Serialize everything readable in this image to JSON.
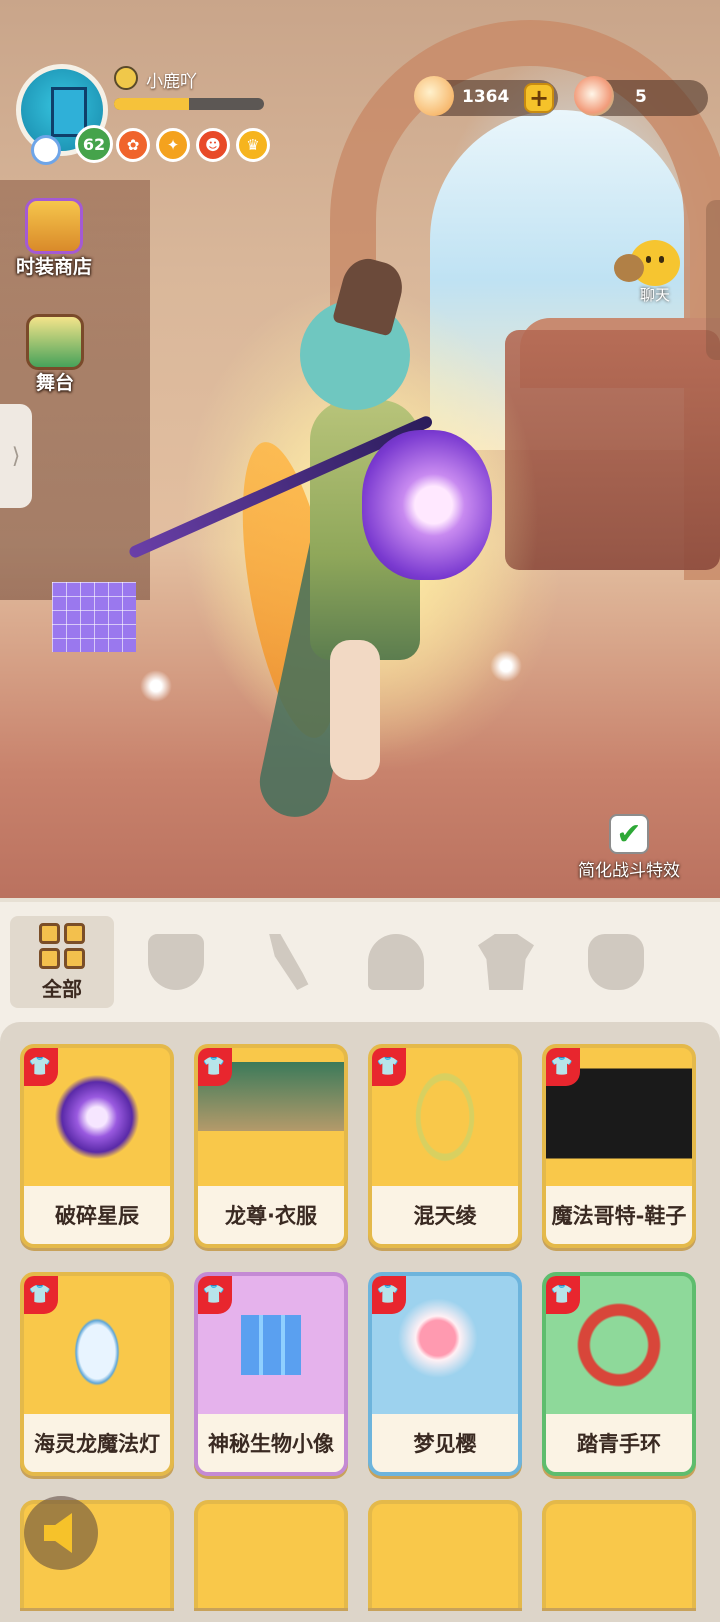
{
  "player": {
    "name": "小鹿吖",
    "level": "62",
    "exp_progress": 0.5
  },
  "currency": {
    "coins": "1364",
    "gems": "5"
  },
  "side_buttons": {
    "fashion_shop": "时装商店",
    "stage": "舞台"
  },
  "chat": {
    "label": "聊天"
  },
  "simplify_effects": {
    "label": "简化战斗特效",
    "checked": true,
    "check_glyph": "✔"
  },
  "drawer_glyph": "⟩",
  "tabs": [
    {
      "label": "全部",
      "active": true,
      "icon": "grid-icon"
    },
    {
      "label": "",
      "icon": "mask-icon"
    },
    {
      "label": "",
      "icon": "weapon-icon"
    },
    {
      "label": "",
      "icon": "hair-icon"
    },
    {
      "label": "",
      "icon": "clothes-icon"
    },
    {
      "label": "",
      "icon": "pet-icon"
    }
  ],
  "items": [
    {
      "name": "破碎星辰",
      "color": "#f9c84a",
      "tag": "shirt-tag-icon"
    },
    {
      "name": "龙尊·衣服",
      "color": "#f9c84a",
      "tag": "multi-shirt-tag-icon"
    },
    {
      "name": "混天绫",
      "color": "#f9c84a",
      "tag": "shirt-tag-icon"
    },
    {
      "name": "魔法哥特-鞋子",
      "color": "#f9c84a",
      "tag": "multi-shirt-tag-icon"
    },
    {
      "name": "海灵龙魔法灯",
      "color": "#f9c84a",
      "tag": "shirt-tag-icon"
    },
    {
      "name": "神秘生物小像",
      "color": "#e5b2ec",
      "tag": "shirt-tag-icon"
    },
    {
      "name": "梦见樱",
      "color": "#9dd2ee",
      "tag": "shirt-tag-icon"
    },
    {
      "name": "踏青手环",
      "color": "#8ed99a",
      "tag": "multi-shirt-tag-icon"
    }
  ],
  "tag_glyph": "👕"
}
